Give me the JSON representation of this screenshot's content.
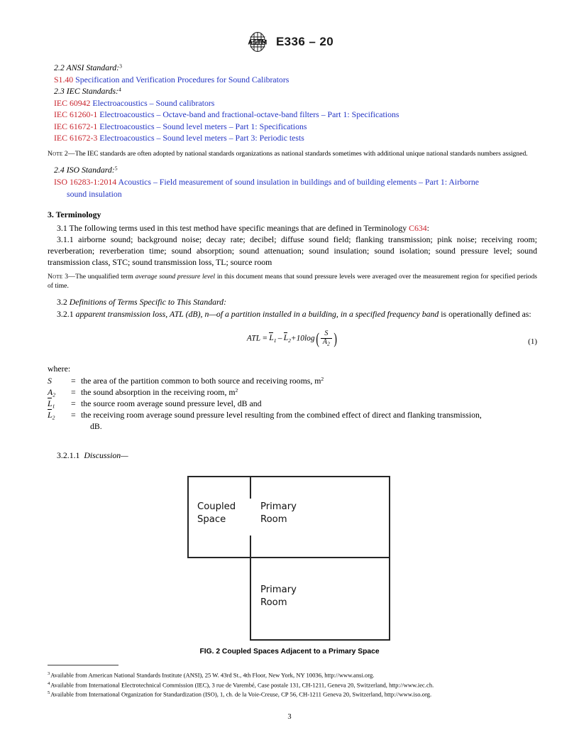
{
  "header": {
    "logo_icon": "astm-logo",
    "title": "E336 – 20"
  },
  "references": {
    "ansi": {
      "heading": "2.2 ANSI Standard:",
      "heading_sup": "3",
      "items": [
        {
          "id": "S1.40",
          "title": "Specification and Verification Procedures for Sound Calibrators"
        }
      ]
    },
    "iec": {
      "heading": "2.3 IEC Standards:",
      "heading_sup": "4",
      "items": [
        {
          "id": "IEC 60942",
          "title": "Electroacoustics – Sound calibrators"
        },
        {
          "id": "IEC 61260-1",
          "title": "Electroacoustics – Octave-band and fractional-octave-band filters – Part 1: Specifications"
        },
        {
          "id": "IEC 61672-1",
          "title": "Electroacoustics – Sound level meters – Part 1: Specifications"
        },
        {
          "id": "IEC 61672-3",
          "title": "Electroacoustics – Sound level meters – Part 3: Periodic tests"
        }
      ]
    },
    "note2": {
      "label": "Note 2—",
      "text": "The IEC standards are often adopted by national standards organizations as national standards sometimes with additional unique national standards numbers assigned."
    },
    "iso": {
      "heading": "2.4 ISO Standard:",
      "heading_sup": "5",
      "items": [
        {
          "id": "ISO 16283-1:2014",
          "title": "Acoustics – Field measurement of sound insulation in buildings and of building elements – Part 1: Airborne",
          "title_cont": "sound insulation"
        }
      ]
    }
  },
  "terminology": {
    "section_heading": "3.  Terminology",
    "p_3_1_num": "3.1",
    "p_3_1_text_a": "The following terms used in this test method have specific meanings that are defined in Terminology ",
    "p_3_1_ref": "C634",
    "p_3_1_text_b": ":",
    "p_3_1_1_num": "3.1.1",
    "p_3_1_1_text": "airborne sound; background noise; decay rate; decibel; diffuse sound field; flanking transmission; pink noise; receiving room; reverberation; reverberation time; sound absorption; sound attenuation; sound insulation; sound isolation; sound pressure level; sound transmission class, STC; sound transmission loss, TL; source room",
    "note3": {
      "label": "Note 3—",
      "text_a": "The unqualified term ",
      "italic": "average sound pressure level",
      "text_b": " in this document means that sound pressure levels were averaged over the measurement region for specified periods of time."
    },
    "p_3_2_num": "3.2",
    "p_3_2_text": "Definitions of Terms Specific to This Standard:",
    "p_3_2_1_num": "3.2.1",
    "p_3_2_1_italic": "apparent transmission loss, ATL (dB), n—of a partition installed in a building, in a specified frequency band",
    "p_3_2_1_text": " is operationally defined as:",
    "p_3_2_1_1_num": "3.2.1.1",
    "p_3_2_1_1_text": "Discussion—"
  },
  "equation": {
    "lhs": "ATL",
    "equals": "=",
    "term_L1": "L",
    "term_L1_sub": "1",
    "minus": "–",
    "term_L2": "L",
    "term_L2_sub": "2",
    "plus": "+",
    "log_coeff": "10log",
    "frac_num": "S",
    "frac_den": "A",
    "frac_den_sub": "2",
    "number": "(1)"
  },
  "where": {
    "label": "where:",
    "definitions": [
      {
        "symbol": "S",
        "symbol_sub": "",
        "eq": "=",
        "text": "the area of the partition common to both source and receiving rooms, m",
        "sup": "2"
      },
      {
        "symbol": "A",
        "symbol_sub": "2",
        "eq": "=",
        "text": "the sound absorption in the receiving room, m",
        "sup": "2"
      },
      {
        "symbol": "L",
        "symbol_sub": "1",
        "overline": true,
        "eq": "=",
        "text": "the source room average sound pressure level, dB and",
        "sup": ""
      },
      {
        "symbol": "L",
        "symbol_sub": "2",
        "overline": true,
        "eq": "=",
        "text": "the receiving room average sound pressure level resulting from the combined effect of direct and flanking transmission,",
        "sup": "",
        "cont": "dB."
      }
    ]
  },
  "figure": {
    "caption": "FIG. 2 Coupled Spaces Adjacent to a Primary Space",
    "rooms": [
      {
        "name": "coupled-space",
        "label": "Coupled\nSpace"
      },
      {
        "name": "primary-room-upper",
        "label": "Primary\nRoom"
      },
      {
        "name": "primary-room-lower",
        "label": "Primary\nRoom"
      }
    ]
  },
  "footnotes": [
    {
      "marker": "3",
      "text": "Available from American National Standards Institute (ANSI), 25 W. 43rd St., 4th Floor, New York, NY 10036, http://www.ansi.org."
    },
    {
      "marker": "4",
      "text": "Available from International Electrotechnical Commission (IEC), 3 rue de Varembé, Case postale 131, CH-1211, Geneva 20, Switzerland, http://www.iec.ch."
    },
    {
      "marker": "5",
      "text": "Available from International Organization for Standardization (ISO), 1, ch. de la Voie-Creuse, CP 56, CH-1211 Geneva 20, Switzerland, http://www.iso.org."
    }
  ],
  "page_number": "3",
  "colors": {
    "standard_id": "#c8232c",
    "standard_title": "#2234c4",
    "rule": "#262626"
  }
}
